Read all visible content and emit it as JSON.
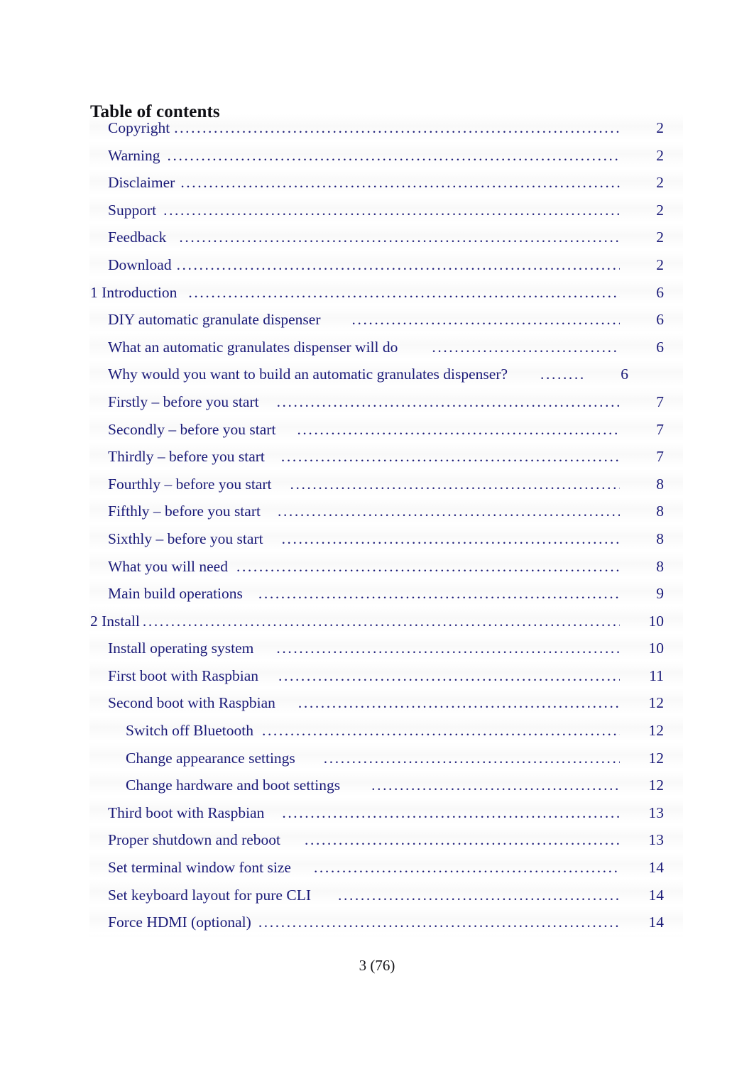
{
  "document": {
    "heading": "Table of contents",
    "footer": "3 (76)"
  },
  "colors": {
    "link": "#1a1a78",
    "text": "#101015",
    "background": "#ffffff"
  },
  "toc": {
    "entries": [
      {
        "label": "Copyright",
        "page": "2",
        "level": 2,
        "gap": 6,
        "leader": "full"
      },
      {
        "label": "Warning",
        "page": "2",
        "level": 2,
        "gap": 10,
        "leader": "full"
      },
      {
        "label": "Disclaimer",
        "page": "2",
        "level": 2,
        "gap": 8,
        "leader": "full"
      },
      {
        "label": "Support",
        "page": "2",
        "level": 2,
        "gap": 10,
        "leader": "full"
      },
      {
        "label": "Feedback",
        "page": "2",
        "level": 2,
        "gap": 18,
        "leader": "full"
      },
      {
        "label": "Download",
        "page": "2",
        "level": 2,
        "gap": 7,
        "leader": "full"
      },
      {
        "label": "1 Introduction",
        "page": "6",
        "level": 1,
        "gap": 16,
        "leader": "full"
      },
      {
        "label": "DIY automatic granulate dispenser",
        "page": "6",
        "level": 2,
        "gap": 44,
        "leader": "full"
      },
      {
        "label": "What an automatic granulates dispenser will do",
        "page": "6",
        "level": 2,
        "gap": 48,
        "leader": "full"
      },
      {
        "label": "Why would you want to build an automatic granulates dispenser?",
        "page": "6",
        "level": 2,
        "gap": 46,
        "leader": "xshort"
      },
      {
        "label": "Firstly – before you start",
        "page": "7",
        "level": 2,
        "gap": 25,
        "leader": "full"
      },
      {
        "label": "Secondly – before you start",
        "page": "7",
        "level": 2,
        "gap": 30,
        "leader": "full"
      },
      {
        "label": "Thirdly – before you start",
        "page": "7",
        "level": 2,
        "gap": 23,
        "leader": "full"
      },
      {
        "label": "Fourthly – before you start",
        "page": "8",
        "level": 2,
        "gap": 26,
        "leader": "full"
      },
      {
        "label": "Fifthly – before you start",
        "page": "8",
        "level": 2,
        "gap": 24,
        "leader": "full"
      },
      {
        "label": "Sixthly – before you start",
        "page": "8",
        "level": 2,
        "gap": 26,
        "leader": "full"
      },
      {
        "label": "What you will need",
        "page": "8",
        "level": 2,
        "gap": 12,
        "leader": "full"
      },
      {
        "label": "Main build operations",
        "page": "9",
        "level": 2,
        "gap": 22,
        "leader": "full"
      },
      {
        "label": "2 Install",
        "page": "10",
        "level": 1,
        "gap": 4,
        "leader": "full"
      },
      {
        "label": "Install operating system",
        "page": "10",
        "level": 2,
        "gap": 32,
        "leader": "full"
      },
      {
        "label": "First boot with Raspbian",
        "page": "11",
        "level": 2,
        "gap": 28,
        "leader": "full"
      },
      {
        "label": "Second boot with Raspbian",
        "page": "12",
        "level": 2,
        "gap": 32,
        "leader": "full"
      },
      {
        "label": "Switch off Bluetooth",
        "page": "12",
        "level": 3,
        "gap": 12,
        "leader": "full"
      },
      {
        "label": "Change appearance settings",
        "page": "12",
        "level": 3,
        "gap": 40,
        "leader": "full"
      },
      {
        "label": "Change hardware and boot settings",
        "page": "12",
        "level": 3,
        "gap": 44,
        "leader": "full"
      },
      {
        "label": "Third boot with Raspbian",
        "page": "13",
        "level": 2,
        "gap": 25,
        "leader": "full"
      },
      {
        "label": "Proper shutdown and reboot",
        "page": "13",
        "level": 2,
        "gap": 34,
        "leader": "full"
      },
      {
        "label": "Set terminal window font size",
        "page": "14",
        "level": 2,
        "gap": 32,
        "leader": "full"
      },
      {
        "label": "Set keyboard layout for pure CLI",
        "page": "14",
        "level": 2,
        "gap": 38,
        "leader": "full"
      },
      {
        "label": "Force HDMI (optional)",
        "page": "14",
        "level": 2,
        "gap": 10,
        "leader": "full"
      }
    ]
  }
}
